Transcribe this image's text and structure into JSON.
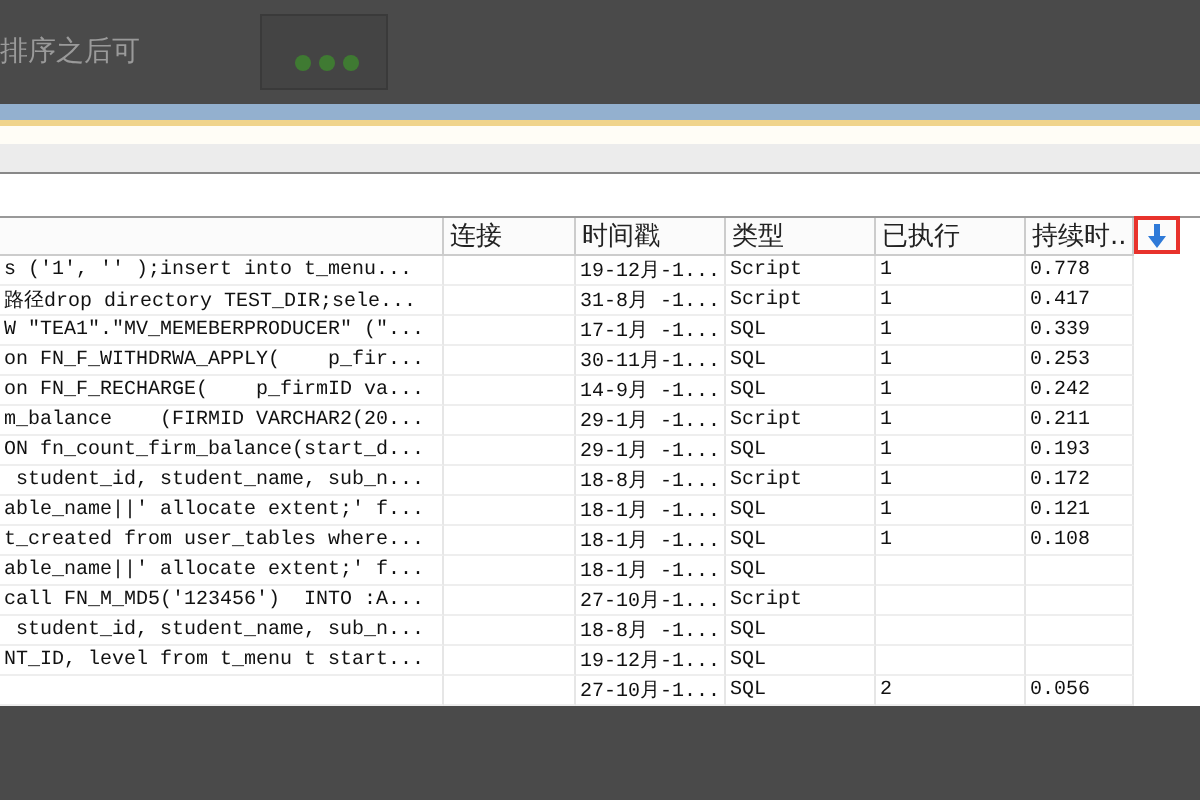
{
  "caption": "排序之后可",
  "table": {
    "columns": [
      {},
      {
        "label": "连接"
      },
      {
        "label": "时间戳"
      },
      {
        "label": "类型"
      },
      {
        "label": "已执行"
      },
      {
        "label": "持续时.."
      }
    ],
    "sort": {
      "selected": true
    },
    "rows": [
      {
        "cells": [
          "s ('1', '' );insert into t_menu...",
          "",
          "19-12月-1...",
          "Script",
          "1",
          "0.778"
        ]
      },
      {
        "cells": [
          "路径drop directory TEST_DIR;sele...",
          "",
          "31-8月 -1...",
          "Script",
          "1",
          "0.417"
        ]
      },
      {
        "cells": [
          "W \"TEA1\".\"MV_MEMEBERPRODUCER\" (\"...",
          "",
          "17-1月 -1...",
          "SQL",
          "1",
          "0.339"
        ]
      },
      {
        "cells": [
          "on FN_F_WITHDRWA_APPLY(    p_fir...",
          "",
          "30-11月-1...",
          "SQL",
          "1",
          "0.253"
        ]
      },
      {
        "cells": [
          "on FN_F_RECHARGE(    p_firmID va...",
          "",
          "14-9月 -1...",
          "SQL",
          "1",
          "0.242"
        ]
      },
      {
        "cells": [
          "m_balance    (FIRMID VARCHAR2(20...",
          "",
          "29-1月 -1...",
          "Script",
          "1",
          "0.211"
        ]
      },
      {
        "cells": [
          "ON fn_count_firm_balance(start_d...",
          "",
          "29-1月 -1...",
          "SQL",
          "1",
          "0.193"
        ]
      },
      {
        "cells": [
          " student_id, student_name, sub_n...",
          "",
          "18-8月 -1...",
          "Script",
          "1",
          "0.172"
        ]
      },
      {
        "cells": [
          "able_name||' allocate extent;' f...",
          "",
          "18-1月 -1...",
          "SQL",
          "1",
          "0.121"
        ]
      },
      {
        "cells": [
          "t_created from user_tables where...",
          "",
          "18-1月 -1...",
          "SQL",
          "1",
          "0.108"
        ]
      },
      {
        "cells": [
          "able_name||' allocate extent;' f...",
          "",
          "18-1月 -1...",
          "SQL",
          "",
          ""
        ]
      },
      {
        "cells": [
          "call FN_M_MD5('123456')  INTO :A...",
          "",
          "27-10月-1...",
          "Script",
          "",
          ""
        ]
      },
      {
        "cells": [
          " student_id, student_name, sub_n...",
          "",
          "18-8月 -1...",
          "SQL",
          "",
          ""
        ]
      },
      {
        "cells": [
          "NT_ID, level from t_menu t start...",
          "",
          "19-12月-1...",
          "SQL",
          "",
          ""
        ]
      },
      {
        "cells": [
          "",
          "",
          "27-10月-1...",
          "SQL",
          "2",
          "0.056"
        ]
      }
    ]
  }
}
